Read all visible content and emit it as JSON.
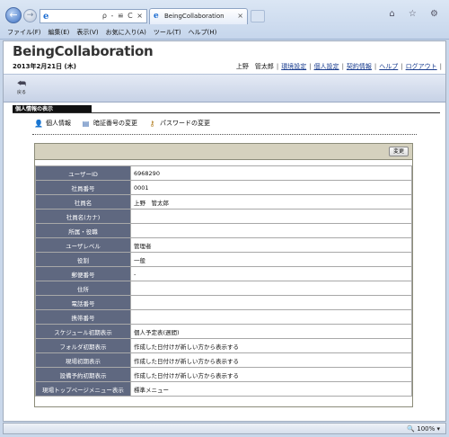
{
  "browser": {
    "tab_title": "BeingCollaboration",
    "addr_tools": "ρ - ≌ C ×",
    "tab_close": "×",
    "right_icons": "⌂ ☆ ⚙",
    "menu": [
      "ファイル(F)",
      "編集(E)",
      "表示(V)",
      "お気に入り(A)",
      "ツール(T)",
      "ヘルプ(H)"
    ]
  },
  "header": {
    "brand": "BeingCollaboration",
    "date": "2013年2月21日 (木)",
    "username": "上野　管太郎",
    "links": [
      "環境設定",
      "個人設定",
      "契約情報",
      "ヘルプ",
      "ログアウト"
    ]
  },
  "toolbar": {
    "back_label": "戻る"
  },
  "section_title": "個人情報の表示",
  "subtabs": [
    "個人情報",
    "暗証番号の変更",
    "パスワードの変更"
  ],
  "panel": {
    "change_button": "変更",
    "rows": [
      {
        "label": "ユーザーID",
        "value": "6968290"
      },
      {
        "label": "社員番号",
        "value": "0001"
      },
      {
        "label": "社員名",
        "value": "上野　管太郎"
      },
      {
        "label": "社員名(カナ)",
        "value": ""
      },
      {
        "label": "所属・役職",
        "value": ""
      },
      {
        "label": "ユーザレベル",
        "value": "管理者"
      },
      {
        "label": "役割",
        "value": "一般"
      },
      {
        "label": "郵便番号",
        "value": "-"
      },
      {
        "label": "住所",
        "value": ""
      },
      {
        "label": "電話番号",
        "value": ""
      },
      {
        "label": "携帯番号",
        "value": ""
      },
      {
        "label": "スケジュール初期表示",
        "value": "個人予定表(週間)"
      },
      {
        "label": "フォルダ初期表示",
        "value": "作成した日付けが新しい方から表示する"
      },
      {
        "label": "現場初期表示",
        "value": "作成した日付けが新しい方から表示する"
      },
      {
        "label": "設備予約初期表示",
        "value": "作成した日付けが新しい方から表示する"
      },
      {
        "label": "現場トップページメニュー表示",
        "value": "標準メニュー"
      }
    ]
  },
  "status": {
    "zoom": "100%"
  },
  "icons": {
    "back": "back-arrow-icon",
    "person": "person-icon",
    "card": "card-icon",
    "key": "key-icon"
  }
}
